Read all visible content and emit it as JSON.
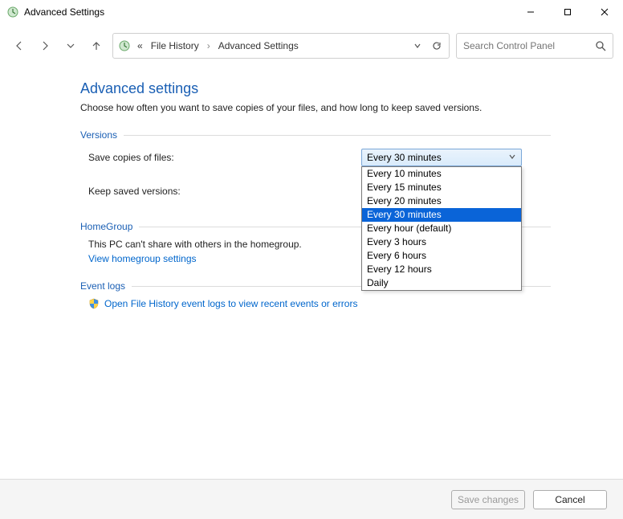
{
  "window": {
    "title": "Advanced Settings"
  },
  "breadcrumb": {
    "prefix": "«",
    "item1": "File History",
    "item2": "Advanced Settings"
  },
  "search": {
    "placeholder": "Search Control Panel"
  },
  "page": {
    "heading": "Advanced settings",
    "subheading": "Choose how often you want to save copies of your files, and how long to keep saved versions."
  },
  "sections": {
    "versions": {
      "title": "Versions",
      "save_copies_label": "Save copies of files:",
      "keep_saved_label": "Keep saved versions:"
    },
    "homegroup": {
      "title": "HomeGroup",
      "body": "This PC can't share with others in the homegroup.",
      "link": "View homegroup settings"
    },
    "eventlogs": {
      "title": "Event logs",
      "link": "Open File History event logs to view recent events or errors"
    }
  },
  "save_copies_combo": {
    "selected": "Every 30 minutes",
    "options": [
      "Every 10 minutes",
      "Every 15 minutes",
      "Every 20 minutes",
      "Every 30 minutes",
      "Every hour (default)",
      "Every 3 hours",
      "Every 6 hours",
      "Every 12 hours",
      "Daily"
    ],
    "highlighted_index": 3
  },
  "footer": {
    "save": "Save changes",
    "cancel": "Cancel"
  }
}
